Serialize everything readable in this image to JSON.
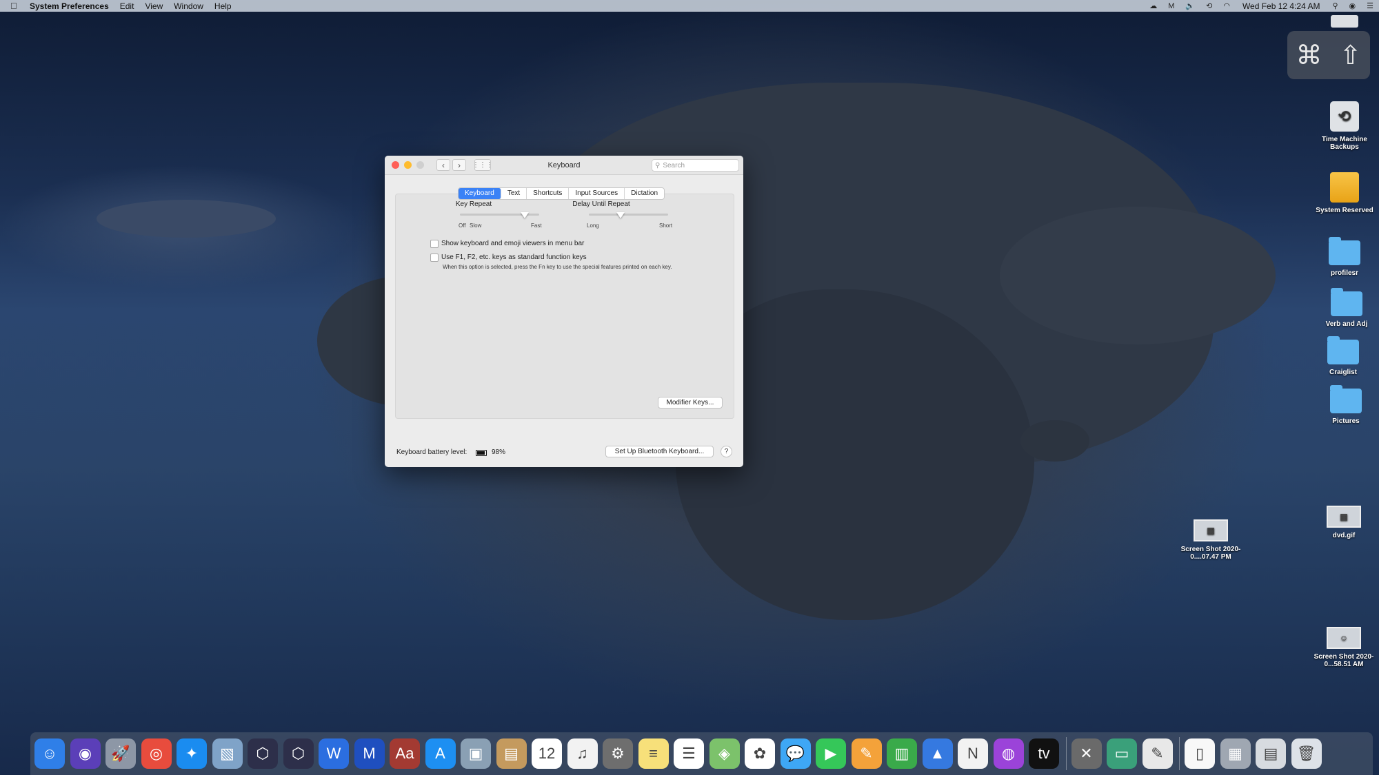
{
  "menubar": {
    "apple_icon": "apple-icon",
    "app_name": "System Preferences",
    "items": [
      "Edit",
      "View",
      "Window",
      "Help"
    ],
    "status_icons": [
      "cloud-sync-icon",
      "malwarebytes-icon",
      "volume-icon",
      "time-machine-icon",
      "wifi-icon"
    ],
    "clock": "Wed Feb 12  4:24 AM",
    "trailing_icons": [
      "spotlight-icon",
      "siri-icon",
      "notification-center-icon"
    ]
  },
  "hud": {
    "icons": [
      "command-key-icon",
      "shift-key-icon"
    ],
    "cmd_glyph": "⌘",
    "shift_glyph": "⇧"
  },
  "desktop": {
    "icons": [
      {
        "label": "",
        "kind": "drive-icon"
      },
      {
        "label": "Time Machine Backups",
        "kind": "time-machine-drive-icon"
      },
      {
        "label": "System Reserved",
        "kind": "drive-icon"
      },
      {
        "label": "profilesr",
        "kind": "folder-icon"
      },
      {
        "label": "Verb and Adj",
        "kind": "folder-icon"
      },
      {
        "label": "Craiglist",
        "kind": "folder-icon"
      },
      {
        "label": "Pictures",
        "kind": "folder-icon"
      },
      {
        "label": "dvd.gif",
        "kind": "image-file-icon"
      },
      {
        "label": "Screen Shot 2020-0....07.47 PM",
        "kind": "image-file-icon"
      },
      {
        "label": "Screen Shot 2020-0...58.51 AM",
        "kind": "image-file-icon"
      }
    ]
  },
  "window": {
    "title": "Keyboard",
    "search_placeholder": "Search",
    "tabs": [
      "Keyboard",
      "Text",
      "Shortcuts",
      "Input Sources",
      "Dictation"
    ],
    "active_tab": "Keyboard",
    "key_repeat": {
      "label": "Key Repeat",
      "left": "Off",
      "left2": "Slow",
      "right": "Fast",
      "value": 0.82
    },
    "delay_until_repeat": {
      "label": "Delay Until Repeat",
      "left": "Long",
      "right": "Short",
      "value": 0.4
    },
    "checkbox1": {
      "label": "Show keyboard and emoji viewers in menu bar",
      "checked": false
    },
    "checkbox2": {
      "label": "Use F1, F2, etc. keys as standard function keys",
      "checked": false,
      "note": "When this option is selected, press the Fn key to use the special features printed on each key."
    },
    "modifier_button": "Modifier Keys...",
    "battery_label": "Keyboard battery level:",
    "battery_value": "98%",
    "bluetooth_button": "Set Up Bluetooth Keyboard...",
    "help": "?"
  },
  "dock": {
    "apps": [
      {
        "name": "finder-icon",
        "color": "#2f7fe8",
        "glyph": "☺"
      },
      {
        "name": "siri-icon",
        "color": "#5b3fb8",
        "glyph": "◉"
      },
      {
        "name": "launchpad-icon",
        "color": "#8d97a6",
        "glyph": "🚀"
      },
      {
        "name": "chrome-icon",
        "color": "#e84c3d",
        "glyph": "◎"
      },
      {
        "name": "safari-icon",
        "color": "#1a8cf0",
        "glyph": "✦"
      },
      {
        "name": "preview-icon",
        "color": "#7fa3c8",
        "glyph": "▧"
      },
      {
        "name": "xcode-instruments-icon",
        "color": "#2d2f4a",
        "glyph": "⬡"
      },
      {
        "name": "xcode-instruments-2-icon",
        "color": "#2d2f4a",
        "glyph": "⬡"
      },
      {
        "name": "word-icon",
        "color": "#2b6ee0",
        "glyph": "W"
      },
      {
        "name": "malwarebytes-icon",
        "color": "#1f4fbf",
        "glyph": "M"
      },
      {
        "name": "dictionary-icon",
        "color": "#a33a32",
        "glyph": "Aa"
      },
      {
        "name": "app-store-icon",
        "color": "#1d8ff2",
        "glyph": "A"
      },
      {
        "name": "image-capture-icon",
        "color": "#8aa0b4",
        "glyph": "▣"
      },
      {
        "name": "contacts-icon",
        "color": "#c49a5e",
        "glyph": "▤"
      },
      {
        "name": "calendar-icon",
        "color": "#ffffff",
        "glyph": "12"
      },
      {
        "name": "music-icon",
        "color": "#f2f2f2",
        "glyph": "♫"
      },
      {
        "name": "system-preferences-icon",
        "color": "#6e6e6e",
        "glyph": "⚙"
      },
      {
        "name": "notes-icon",
        "color": "#f7e07a",
        "glyph": "≡"
      },
      {
        "name": "reminders-icon",
        "color": "#ffffff",
        "glyph": "☰"
      },
      {
        "name": "maps-icon",
        "color": "#7cc26b",
        "glyph": "◈"
      },
      {
        "name": "photos-icon",
        "color": "#ffffff",
        "glyph": "✿"
      },
      {
        "name": "messages-icon",
        "color": "#3ea7f5",
        "glyph": "💬"
      },
      {
        "name": "facetime-icon",
        "color": "#35c759",
        "glyph": "▶"
      },
      {
        "name": "pages-icon",
        "color": "#f4a23a",
        "glyph": "✎"
      },
      {
        "name": "numbers-icon",
        "color": "#3aaa4a",
        "glyph": "▥"
      },
      {
        "name": "keynote-icon",
        "color": "#3579e0",
        "glyph": "▲"
      },
      {
        "name": "news-icon",
        "color": "#f2f2f2",
        "glyph": "N"
      },
      {
        "name": "podcasts-icon",
        "color": "#9b43d9",
        "glyph": "◍"
      },
      {
        "name": "apple-tv-icon",
        "color": "#111111",
        "glyph": "tv"
      },
      {
        "name": "utilities-icon",
        "color": "#6a6a6a",
        "glyph": "✕"
      },
      {
        "name": "screen-sharing-icon",
        "color": "#3aa07a",
        "glyph": "▭"
      },
      {
        "name": "textedit-icon",
        "color": "#e8e8e8",
        "glyph": "✎"
      },
      {
        "name": "document-icon",
        "color": "#f8f8f8",
        "glyph": "▯"
      },
      {
        "name": "downloads-stack-icon",
        "color": "#9fa7b2",
        "glyph": "▦"
      },
      {
        "name": "screenshots-stack-icon",
        "color": "#d7dbe0",
        "glyph": "▤"
      },
      {
        "name": "trash-icon",
        "color": "#dde2e8",
        "glyph": "🗑"
      }
    ]
  }
}
